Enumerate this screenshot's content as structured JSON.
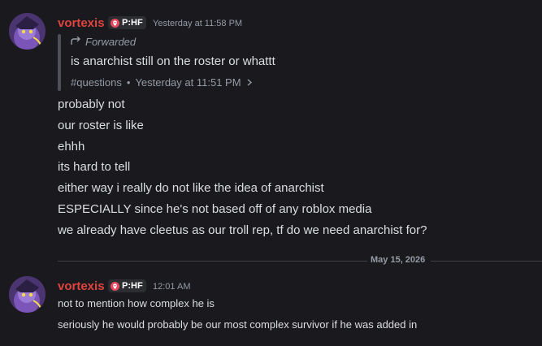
{
  "messages": [
    {
      "author": "vortexis",
      "tag": "P:HF",
      "timestamp": "Yesterday at 11:58 PM",
      "forwarded": {
        "label": "Forwarded",
        "text": "is anarchist still on the roster or whattt",
        "channel": "#questions",
        "separator": "•",
        "time": "Yesterday at 11:51 PM"
      },
      "lines": [
        "probably not",
        "our roster is like",
        "ehhh",
        "its hard to tell",
        "either way i really do not like the idea of anarchist",
        "ESPECIALLY since he's not based off of any roblox media",
        "we already have cleetus as our troll rep, tf do we need anarchist for?"
      ]
    },
    {
      "author": "vortexis",
      "tag": "P:HF",
      "timestamp": "12:01 AM",
      "lines": [
        "not to mention how complex he is",
        "seriously he would probably be our most complex survivor if he was added in"
      ]
    }
  ],
  "date_divider": "May 15, 2026",
  "colors": {
    "background": "#1a1a1e",
    "username": "#e0443f",
    "tag_bg": "#2b2d31",
    "tag_icon": "#e8485f",
    "text": "#dbdee1",
    "muted": "#949ba4"
  },
  "icons": {
    "forward": "forward-arrow-icon",
    "tag": "skull-icon",
    "jump": "chevron-right-icon"
  }
}
